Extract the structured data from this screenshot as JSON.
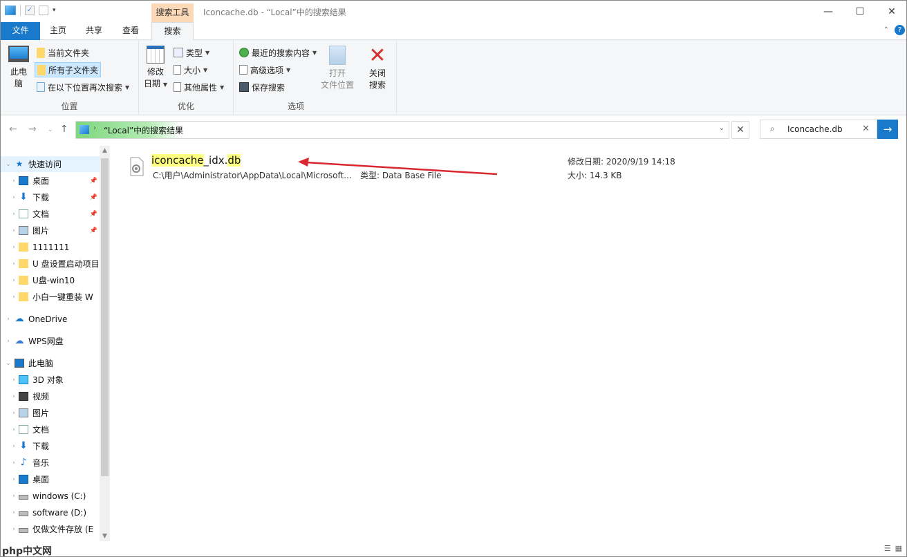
{
  "window": {
    "title": "Iconcache.db - “Local”中的搜索结果",
    "context_tab": "搜索工具"
  },
  "tabs": {
    "file": "文件",
    "home": "主页",
    "share": "共享",
    "view": "查看",
    "search": "搜索"
  },
  "ribbon": {
    "location": {
      "this_pc": [
        "此电",
        "脑"
      ],
      "current_folder": "当前文件夹",
      "all_subfolders": "所有子文件夹",
      "search_again": "在以下位置再次搜索",
      "label": "位置"
    },
    "refine": {
      "date_modified": [
        "修改",
        "日期"
      ],
      "kind": "类型",
      "size": "大小",
      "other_props": "其他属性",
      "label": "优化"
    },
    "options": {
      "recent": "最近的搜索内容",
      "advanced": "高级选项",
      "save": "保存搜索",
      "open_location": [
        "打开",
        "文件位置"
      ],
      "close": [
        "关闭",
        "搜索"
      ],
      "label": "选项"
    }
  },
  "address": {
    "path": "“Local”中的搜索结果",
    "search_value": "Iconcache.db"
  },
  "nav": [
    {
      "label": "快速访问",
      "icon": "star-icon",
      "level": 0,
      "hover": true
    },
    {
      "label": "桌面",
      "icon": "desktop-icon",
      "level": 1,
      "pin": true
    },
    {
      "label": "下载",
      "icon": "download-icon",
      "level": 1,
      "pin": true
    },
    {
      "label": "文档",
      "icon": "document-icon",
      "level": 1,
      "pin": true
    },
    {
      "label": "图片",
      "icon": "pictures-icon",
      "level": 1,
      "pin": true
    },
    {
      "label": "1111111",
      "icon": "folder-icon",
      "level": 1
    },
    {
      "label": "U 盘设置启动项目",
      "icon": "folder-icon",
      "level": 1
    },
    {
      "label": "U盘-win10",
      "icon": "folder-icon",
      "level": 1
    },
    {
      "label": "小白一键重装 W",
      "icon": "folder-icon",
      "level": 1
    },
    {
      "label": "OneDrive",
      "icon": "cloud-icon",
      "level": 0
    },
    {
      "label": "WPS网盘",
      "icon": "wps-cloud-icon",
      "level": 0
    },
    {
      "label": "此电脑",
      "icon": "computer-icon",
      "level": 0
    },
    {
      "label": "3D 对象",
      "icon": "3d-objects-icon",
      "level": 1
    },
    {
      "label": "视频",
      "icon": "video-icon",
      "level": 1
    },
    {
      "label": "图片",
      "icon": "pictures-icon",
      "level": 1
    },
    {
      "label": "文档",
      "icon": "document-icon",
      "level": 1
    },
    {
      "label": "下载",
      "icon": "download-icon",
      "level": 1
    },
    {
      "label": "音乐",
      "icon": "music-icon",
      "level": 1
    },
    {
      "label": "桌面",
      "icon": "desktop-icon",
      "level": 1
    },
    {
      "label": "windows (C:)",
      "icon": "drive-icon",
      "level": 1
    },
    {
      "label": "software (D:)",
      "icon": "drive-icon",
      "level": 1
    },
    {
      "label": "仅做文件存放 (E",
      "icon": "drive-icon",
      "level": 1
    }
  ],
  "result": {
    "name_parts": [
      "iconcache",
      "_idx.",
      "db"
    ],
    "path": "C:\\用户\\Administrator\\AppData\\Local\\Microsoft...",
    "type_label": "类型:",
    "type_value": "Data Base File",
    "date_label": "修改日期:",
    "date_value": "2020/9/19 14:18",
    "size_label": "大小:",
    "size_value": "14.3 KB"
  },
  "watermark": "php中文网",
  "colors": {
    "accent": "#1979ca",
    "arrow": "#d9262f",
    "highlight": "#ffff80"
  }
}
